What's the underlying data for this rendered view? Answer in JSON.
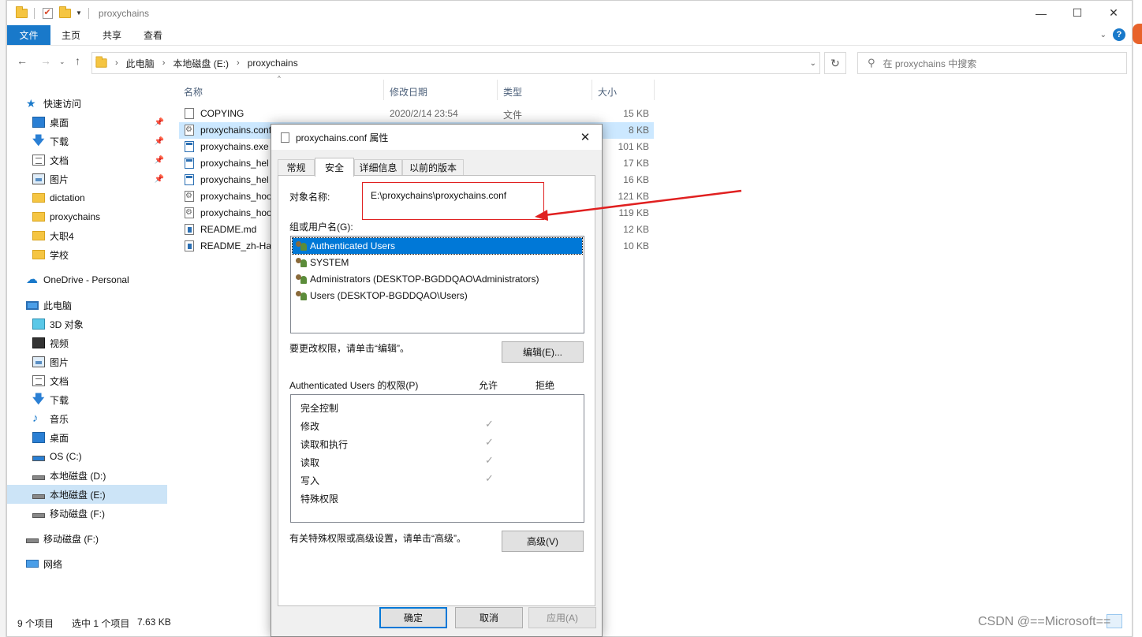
{
  "titlebar": {
    "title": "proxychains",
    "minimize": "—",
    "maximize": "☐",
    "close": "✕"
  },
  "ribbon": {
    "tabs": [
      "文件",
      "主页",
      "共享",
      "查看"
    ],
    "help": "?"
  },
  "address": {
    "crumbs": [
      "此电脑",
      "本地磁盘 (E:)",
      "proxychains"
    ],
    "search_placeholder": "在 proxychains 中搜索"
  },
  "sidebar": {
    "items": [
      {
        "label": "快速访问",
        "icon": "star-icon"
      },
      {
        "label": "桌面",
        "icon": "desktop-icon"
      },
      {
        "label": "下载",
        "icon": "download-icon"
      },
      {
        "label": "文档",
        "icon": "documents-icon"
      },
      {
        "label": "图片",
        "icon": "pictures-icon"
      },
      {
        "label": "dictation",
        "icon": "folder-icon"
      },
      {
        "label": "proxychains",
        "icon": "folder-icon"
      },
      {
        "label": "大职4",
        "icon": "folder-icon"
      },
      {
        "label": "学校",
        "icon": "folder-icon"
      },
      {
        "label": "OneDrive - Personal",
        "icon": "cloud-icon"
      },
      {
        "label": "此电脑",
        "icon": "pc-icon"
      },
      {
        "label": "3D 对象",
        "icon": "3d-objects-icon"
      },
      {
        "label": "视频",
        "icon": "video-icon"
      },
      {
        "label": "图片",
        "icon": "pictures-icon"
      },
      {
        "label": "文档",
        "icon": "documents-icon"
      },
      {
        "label": "下载",
        "icon": "download-icon"
      },
      {
        "label": "音乐",
        "icon": "music-icon"
      },
      {
        "label": "桌面",
        "icon": "desktop-icon"
      },
      {
        "label": "OS (C:)",
        "icon": "os-drive-icon"
      },
      {
        "label": "本地磁盘 (D:)",
        "icon": "drive-icon"
      },
      {
        "label": "本地磁盘 (E:)",
        "icon": "drive-icon"
      },
      {
        "label": "移动磁盘 (F:)",
        "icon": "drive-icon"
      },
      {
        "label": "移动磁盘 (F:)",
        "icon": "drive-icon"
      },
      {
        "label": "网络",
        "icon": "network-icon"
      }
    ]
  },
  "filelist": {
    "columns": [
      "名称",
      "修改日期",
      "类型",
      "大小"
    ],
    "rows": [
      {
        "name": "COPYING",
        "date": "2020/2/14 23:54",
        "type": "文件",
        "size": "15 KB",
        "icon": "file-icon"
      },
      {
        "name": "proxychains.conf",
        "date": "",
        "type": "",
        "size": "8 KB",
        "icon": "config-file-icon"
      },
      {
        "name": "proxychains.exe",
        "date": "",
        "type": "",
        "size": "101 KB",
        "icon": "exe-icon"
      },
      {
        "name": "proxychains_hel",
        "date": "",
        "type": "",
        "size": "17 KB",
        "icon": "exe-icon"
      },
      {
        "name": "proxychains_hel",
        "date": "",
        "type": "",
        "size": "16 KB",
        "icon": "exe-icon"
      },
      {
        "name": "proxychains_hoo",
        "date": "",
        "type": "",
        "size": "121 KB",
        "icon": "config-file-icon"
      },
      {
        "name": "proxychains_hoo",
        "date": "",
        "type": "",
        "size": "119 KB",
        "icon": "config-file-icon"
      },
      {
        "name": "README.md",
        "date": "",
        "type": "",
        "size": "12 KB",
        "icon": "markdown-file-icon"
      },
      {
        "name": "README_zh-Ha",
        "date": "",
        "type": "",
        "size": "10 KB",
        "icon": "markdown-file-icon"
      }
    ]
  },
  "status": {
    "count": "9 个项目",
    "selected": "选中 1 个项目",
    "size": "7.63 KB"
  },
  "dialog": {
    "title": "proxychains.conf 属性",
    "tabs": [
      "常规",
      "安全",
      "详细信息",
      "以前的版本"
    ],
    "object_label": "对象名称:",
    "object_value": "E:\\proxychains\\proxychains.conf",
    "groups_label": "组或用户名(G):",
    "groups": [
      "Authenticated Users",
      "SYSTEM",
      "Administrators (DESKTOP-BGDDQAO\\Administrators)",
      "Users (DESKTOP-BGDDQAO\\Users)"
    ],
    "change_text": "要更改权限，请单击“编辑”。",
    "edit_button": "编辑(E)...",
    "perm_label": "Authenticated Users 的权限(P)",
    "allow_label": "允许",
    "deny_label": "拒绝",
    "permissions": [
      {
        "name": "完全控制",
        "allow": ""
      },
      {
        "name": "修改",
        "allow": "✓"
      },
      {
        "name": "读取和执行",
        "allow": "✓"
      },
      {
        "name": "读取",
        "allow": "✓"
      },
      {
        "name": "写入",
        "allow": "✓"
      },
      {
        "name": "特殊权限",
        "allow": ""
      }
    ],
    "advanced_text": "有关特殊权限或高级设置，请单击“高级”。",
    "advanced_button": "高级(V)",
    "ok": "确定",
    "cancel": "取消",
    "apply": "应用(A)",
    "close": "✕"
  },
  "watermark": "CSDN @==Microsoft=="
}
